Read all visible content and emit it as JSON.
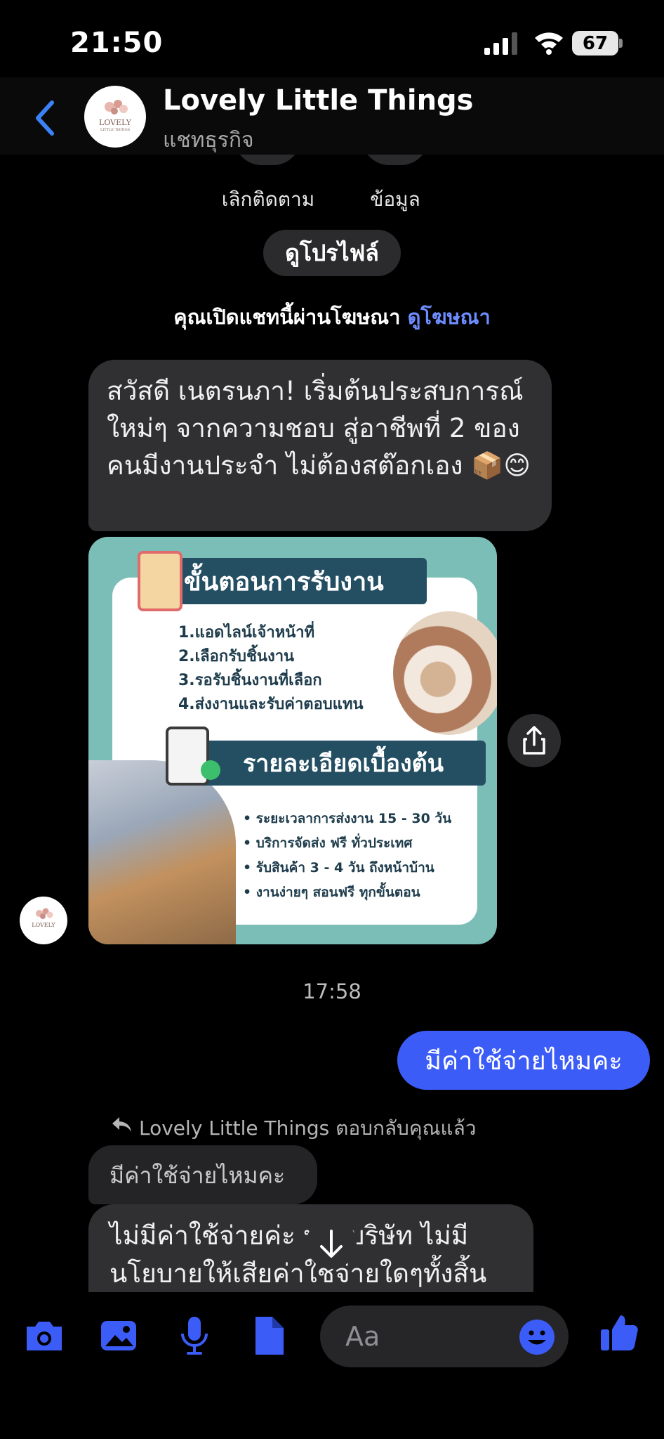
{
  "status": {
    "time": "21:50",
    "battery": "67"
  },
  "header": {
    "name": "Lovely Little Things",
    "subtitle": "แชทธุรกิจ",
    "logo_text": "LOVELY",
    "logo_sub": "LITTLE THINGS"
  },
  "profile": {
    "unfollow_label": "เลิกติดตาม",
    "info_label": "ข้อมูล",
    "view_profile": "ดูโปรไฟล์"
  },
  "ad_note": {
    "text": "คุณเปิดแชทนี้ผ่านโฆษณา ",
    "link": "ดูโฆษณา"
  },
  "messages": {
    "welcome": "สวัสดี เนตรนภา! เริ่มต้นประสบการณ์ใหม่ๆ จากความชอบ สู่อาชีพที่ 2 ของคนมีงานประจำ ไม่ต้องสต๊อกเอง 📦😊",
    "time": "17:58",
    "outgoing": "มีค่าใช้จ่ายไหมคะ",
    "reply_note": "Lovely Little Things ตอบกลับคุณแล้ว",
    "quoted": "มีค่าใช้จ่ายไหมคะ",
    "reply": "ไม่มีค่าใช้จ่ายค่ะ ทางบริษัท ไม่มีนโยบายให้เสียค่าใช้จ่ายใดๆทั้งสิ้น"
  },
  "promo": {
    "title1": "ขั้นตอนการรับงาน",
    "steps": [
      "1.แอดไลน์เจ้าหน้าที่",
      "2.เลือกรับชิ้นงาน",
      "3.รอรับชิ้นงานที่เลือก",
      "4.ส่งงานและรับค่าตอบแทน"
    ],
    "title2": "รายละเอียดเบื้องต้น",
    "details": [
      "ระยะเวลาการส่งงาน 15 - 30 วัน",
      "บริการจัดส่ง ฟรี ทั่วประเทศ",
      "รับสินค้า 3 - 4 วัน ถึงหน้าบ้าน",
      "งานง่ายๆ สอนฟรี ทุกขั้นตอน"
    ]
  },
  "composer": {
    "placeholder": "Aa"
  },
  "colors": {
    "accent": "#3b5cf6",
    "link": "#6d8cff",
    "bubble": "#303033"
  }
}
